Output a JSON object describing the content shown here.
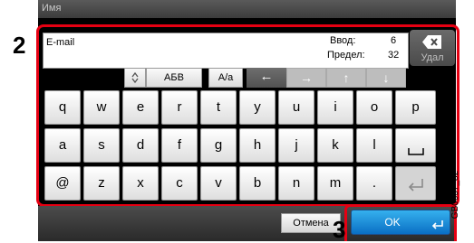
{
  "dialog": {
    "title": "Имя"
  },
  "callouts": {
    "two": "2",
    "three": "3"
  },
  "input": {
    "value": "E-mail",
    "input_label": "Ввод:",
    "input_count": "6",
    "limit_label": "Предел:",
    "limit_count": "32"
  },
  "toolbar": {
    "mode_label": "АБВ",
    "case_label": "A/a",
    "delete_label": "Удал"
  },
  "keyboard": {
    "row1": [
      "q",
      "w",
      "e",
      "r",
      "t",
      "y",
      "u",
      "i",
      "o",
      "p"
    ],
    "row2": [
      "a",
      "s",
      "d",
      "f",
      "g",
      "h",
      "j",
      "k",
      "l",
      "␣"
    ],
    "row3": [
      "@",
      "z",
      "x",
      "c",
      "v",
      "b",
      "n",
      "m",
      "."
    ]
  },
  "footer": {
    "cancel_label": "Отмена",
    "ok_label": "OK"
  },
  "figure_id": "GB0057_82",
  "colors": {
    "highlight": "#e60012",
    "ok": "#1f8fde"
  },
  "icons": [
    "backspace-icon",
    "left-arrow-icon",
    "right-arrow-icon",
    "up-arrow-icon",
    "down-arrow-icon",
    "enter-icon",
    "space-icon"
  ]
}
